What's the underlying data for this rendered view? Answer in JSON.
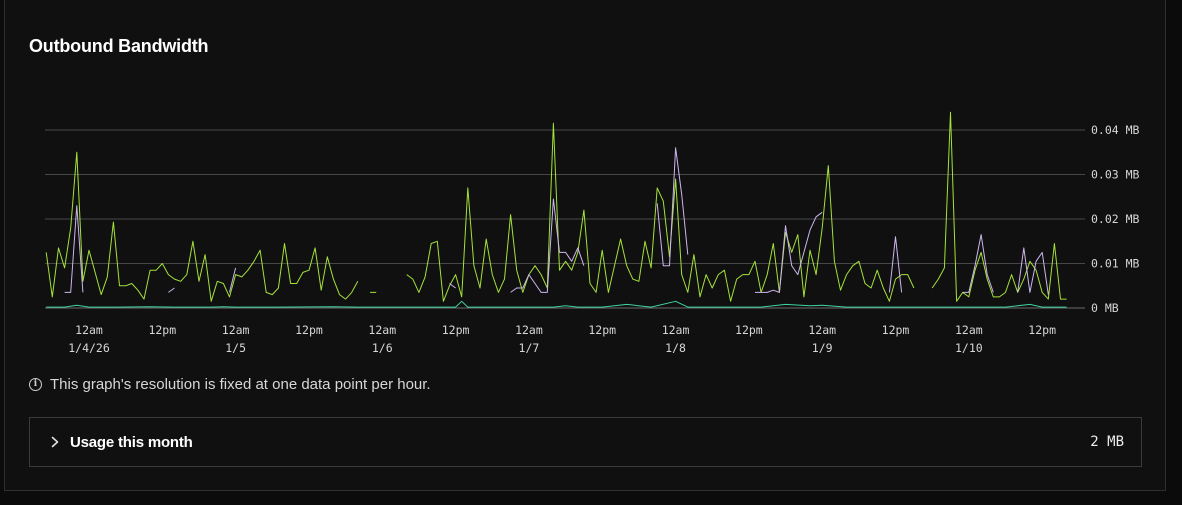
{
  "card": {
    "title": "Outbound Bandwidth",
    "resolution_note": "This graph's resolution is fixed at one data point per hour."
  },
  "usage": {
    "label": "Usage this month",
    "value": "2 MB"
  },
  "colors": {
    "series_green": "#a4e23a",
    "series_purple": "#cdb6ef",
    "series_teal": "#3fd3a0",
    "gridline": "#474747",
    "background": "#101010"
  },
  "chart_data": {
    "type": "line",
    "title": "Outbound Bandwidth",
    "y_unit": "MB",
    "ylim": [
      0,
      0.04
    ],
    "y_ticks": [
      {
        "value": 0,
        "label": "0 MB"
      },
      {
        "value": 0.01,
        "label": "0.01 MB"
      },
      {
        "value": 0.02,
        "label": "0.02 MB"
      },
      {
        "value": 0.03,
        "label": "0.03 MB"
      },
      {
        "value": 0.04,
        "label": "0.04 MB"
      }
    ],
    "x_ticks": [
      {
        "hour": 0,
        "time": "12am",
        "date": "1/4/26"
      },
      {
        "hour": 12,
        "time": "12pm",
        "date": ""
      },
      {
        "hour": 24,
        "time": "12am",
        "date": "1/5"
      },
      {
        "hour": 36,
        "time": "12pm",
        "date": ""
      },
      {
        "hour": 48,
        "time": "12am",
        "date": "1/6"
      },
      {
        "hour": 60,
        "time": "12pm",
        "date": ""
      },
      {
        "hour": 72,
        "time": "12am",
        "date": "1/7"
      },
      {
        "hour": 84,
        "time": "12pm",
        "date": ""
      },
      {
        "hour": 96,
        "time": "12am",
        "date": "1/8"
      },
      {
        "hour": 108,
        "time": "12pm",
        "date": ""
      },
      {
        "hour": 120,
        "time": "12am",
        "date": "1/9"
      },
      {
        "hour": 132,
        "time": "12pm",
        "date": ""
      },
      {
        "hour": 144,
        "time": "12am",
        "date": "1/10"
      },
      {
        "hour": 156,
        "time": "12pm",
        "date": ""
      }
    ],
    "x_range_hours": [
      -7,
      160
    ],
    "grid": true,
    "legend": "none",
    "series": [
      {
        "color": "#a4e23a",
        "points": [
          [
            -7,
            0.0125
          ],
          [
            -6,
            0.0025
          ],
          [
            -5,
            0.0135
          ],
          [
            -4,
            0.009
          ],
          [
            -3,
            0.018
          ],
          [
            -2,
            0.035
          ],
          [
            -1,
            0.006
          ],
          [
            0,
            0.013
          ],
          [
            1,
            0.008
          ],
          [
            2,
            0.003
          ],
          [
            3,
            0.007
          ],
          [
            4,
            0.0193
          ],
          [
            5,
            0.005
          ],
          [
            6,
            0.005
          ],
          [
            7,
            0.0055
          ],
          [
            8,
            0.004
          ],
          [
            9,
            0.002
          ],
          [
            10,
            0.0085
          ],
          [
            11,
            0.0085
          ],
          [
            12,
            0.01
          ],
          [
            13,
            0.0075
          ],
          [
            14,
            0.0065
          ],
          [
            15,
            0.006
          ],
          [
            16,
            0.0075
          ],
          [
            17,
            0.015
          ],
          [
            18,
            0.006
          ],
          [
            19,
            0.012
          ],
          [
            20,
            0.0015
          ],
          [
            21,
            0.006
          ],
          [
            22,
            0.0055
          ],
          [
            23,
            0.0025
          ],
          [
            24,
            0.0075
          ],
          [
            25,
            0.007
          ],
          [
            26,
            0.0085
          ],
          [
            27,
            0.0105
          ],
          [
            28,
            0.013
          ],
          [
            29,
            0.0035
          ],
          [
            30,
            0.003
          ],
          [
            31,
            0.0045
          ],
          [
            32,
            0.0145
          ],
          [
            33,
            0.0055
          ],
          [
            34,
            0.0055
          ],
          [
            35,
            0.008
          ],
          [
            36,
            0.0085
          ],
          [
            37,
            0.0135
          ],
          [
            38,
            0.004
          ],
          [
            39,
            0.0115
          ],
          [
            40,
            0.0065
          ],
          [
            41,
            0.003
          ],
          [
            42,
            0.002
          ],
          [
            43,
            0.0035
          ],
          [
            44,
            0.006
          ],
          [
            null,
            null
          ],
          [
            46,
            0.0035
          ],
          [
            47,
            0.0035
          ],
          [
            null,
            null
          ],
          [
            52,
            0.0075
          ],
          [
            53,
            0.0065
          ],
          [
            54,
            0.0035
          ],
          [
            55,
            0.007
          ],
          [
            56,
            0.0145
          ],
          [
            57,
            0.015
          ],
          [
            58,
            0.0015
          ],
          [
            59,
            0.005
          ],
          [
            60,
            0.0075
          ],
          [
            61,
            0.0025
          ],
          [
            62,
            0.027
          ],
          [
            63,
            0.0095
          ],
          [
            64,
            0.0045
          ],
          [
            65,
            0.0155
          ],
          [
            66,
            0.0075
          ],
          [
            67,
            0.0035
          ],
          [
            68,
            0.0065
          ],
          [
            69,
            0.021
          ],
          [
            70,
            0.0085
          ],
          [
            71,
            0.0035
          ],
          [
            72,
            0.0075
          ],
          [
            73,
            0.0095
          ],
          [
            74,
            0.0075
          ],
          [
            75,
            0.0045
          ],
          [
            76,
            0.0415
          ],
          [
            77,
            0.0085
          ],
          [
            78,
            0.0105
          ],
          [
            79,
            0.0085
          ],
          [
            80,
            0.0125
          ],
          [
            81,
            0.022
          ],
          [
            82,
            0.0055
          ],
          [
            83,
            0.0035
          ],
          [
            84,
            0.013
          ],
          [
            85,
            0.0035
          ],
          [
            86,
            0.0095
          ],
          [
            87,
            0.0155
          ],
          [
            88,
            0.0095
          ],
          [
            89,
            0.0065
          ],
          [
            90,
            0.006
          ],
          [
            91,
            0.015
          ],
          [
            92,
            0.009
          ],
          [
            93,
            0.027
          ],
          [
            94,
            0.024
          ],
          [
            95,
            0.0115
          ],
          [
            96,
            0.029
          ],
          [
            97,
            0.0075
          ],
          [
            98,
            0.0035
          ],
          [
            99,
            0.012
          ],
          [
            100,
            0.0025
          ],
          [
            101,
            0.0075
          ],
          [
            102,
            0.0045
          ],
          [
            103,
            0.0075
          ],
          [
            104,
            0.0085
          ],
          [
            105,
            0.0015
          ],
          [
            106,
            0.0065
          ],
          [
            107,
            0.0075
          ],
          [
            108,
            0.0075
          ],
          [
            109,
            0.0105
          ],
          [
            110,
            0.0035
          ],
          [
            111,
            0.0075
          ],
          [
            112,
            0.0145
          ],
          [
            113,
            0.0035
          ],
          [
            114,
            0.017
          ],
          [
            115,
            0.0125
          ],
          [
            116,
            0.0165
          ],
          [
            117,
            0.0025
          ],
          [
            118,
            0.013
          ],
          [
            119,
            0.0075
          ],
          [
            120,
            0.018
          ],
          [
            121,
            0.032
          ],
          [
            122,
            0.0105
          ],
          [
            123,
            0.004
          ],
          [
            124,
            0.0075
          ],
          [
            125,
            0.0095
          ],
          [
            126,
            0.0105
          ],
          [
            127,
            0.0055
          ],
          [
            128,
            0.0045
          ],
          [
            129,
            0.0085
          ],
          [
            130,
            0.0045
          ],
          [
            131,
            0.0015
          ],
          [
            132,
            0.0065
          ],
          [
            133,
            0.0075
          ],
          [
            134,
            0.0075
          ],
          [
            135,
            0.0045
          ],
          [
            null,
            null
          ],
          [
            138,
            0.0045
          ],
          [
            139,
            0.0065
          ],
          [
            140,
            0.009
          ],
          [
            141,
            0.044
          ],
          [
            142,
            0.0015
          ],
          [
            143,
            0.0035
          ],
          [
            144,
            0.0025
          ],
          [
            145,
            0.0085
          ],
          [
            146,
            0.0125
          ],
          [
            147,
            0.0065
          ],
          [
            148,
            0.0025
          ],
          [
            149,
            0.0025
          ],
          [
            150,
            0.0035
          ],
          [
            151,
            0.0075
          ],
          [
            152,
            0.0035
          ],
          [
            153,
            0.0065
          ],
          [
            154,
            0.0105
          ],
          [
            155,
            0.0085
          ],
          [
            156,
            0.0035
          ],
          [
            157,
            0.002
          ],
          [
            158,
            0.0145
          ],
          [
            159,
            0.002
          ],
          [
            160,
            0.002
          ]
        ]
      },
      {
        "color": "#cdb6ef",
        "points": [
          [
            -4,
            0.0035
          ],
          [
            -3,
            0.0035
          ],
          [
            -2,
            0.023
          ],
          [
            -1,
            0.0035
          ],
          [
            null,
            null
          ],
          [
            13,
            0.0035
          ],
          [
            14,
            0.0045
          ],
          [
            null,
            null
          ],
          [
            23,
            0.0035
          ],
          [
            24,
            0.009
          ],
          [
            null,
            null
          ],
          [
            59,
            0.0055
          ],
          [
            60,
            0.0045
          ],
          [
            null,
            null
          ],
          [
            69,
            0.0035
          ],
          [
            70,
            0.0045
          ],
          [
            71,
            0.0045
          ],
          [
            72,
            0.0075
          ],
          [
            73,
            0.0055
          ],
          [
            74,
            0.0035
          ],
          [
            75,
            0.0035
          ],
          [
            76,
            0.0245
          ],
          [
            77,
            0.0125
          ],
          [
            78,
            0.0125
          ],
          [
            79,
            0.0105
          ],
          [
            80,
            0.0135
          ],
          [
            81,
            0.0095
          ],
          [
            null,
            null
          ],
          [
            93,
            0.0235
          ],
          [
            94,
            0.0095
          ],
          [
            95,
            0.0095
          ],
          [
            96,
            0.036
          ],
          [
            97,
            0.0255
          ],
          [
            98,
            0.012
          ],
          [
            null,
            null
          ],
          [
            109,
            0.0035
          ],
          [
            110,
            0.0035
          ],
          [
            111,
            0.0035
          ],
          [
            112,
            0.004
          ],
          [
            113,
            0.0035
          ],
          [
            114,
            0.0185
          ],
          [
            115,
            0.0095
          ],
          [
            116,
            0.0075
          ],
          [
            117,
            0.0125
          ],
          [
            118,
            0.0175
          ],
          [
            119,
            0.0205
          ],
          [
            120,
            0.0215
          ],
          [
            null,
            null
          ],
          [
            131,
            0.0035
          ],
          [
            132,
            0.016
          ],
          [
            133,
            0.0035
          ],
          [
            null,
            null
          ],
          [
            143,
            0.0035
          ],
          [
            144,
            0.0035
          ],
          [
            145,
            0.0095
          ],
          [
            146,
            0.0165
          ],
          [
            147,
            0.0075
          ],
          [
            148,
            0.0035
          ],
          [
            null,
            null
          ],
          [
            152,
            0.0035
          ],
          [
            153,
            0.0135
          ],
          [
            154,
            0.0035
          ],
          [
            155,
            0.0105
          ],
          [
            156,
            0.0125
          ],
          [
            157,
            0.003
          ]
        ]
      },
      {
        "color": "#3fd3a0",
        "points": [
          [
            -7,
            0.0002
          ],
          [
            -4,
            0.0002
          ],
          [
            -2,
            0.0006
          ],
          [
            0,
            0.0002
          ],
          [
            4,
            0.0002
          ],
          [
            10,
            0.0003
          ],
          [
            14,
            0.0002
          ],
          [
            16,
            0.0002
          ],
          [
            18,
            0.0002
          ],
          [
            20,
            0.0002
          ],
          [
            22,
            0.0003
          ],
          [
            24,
            0.0002
          ],
          [
            30,
            0.0002
          ],
          [
            40,
            0.0003
          ],
          [
            44,
            0.0002
          ],
          [
            48,
            0.0002
          ],
          [
            54,
            0.0002
          ],
          [
            60,
            0.0002
          ],
          [
            61,
            0.0015
          ],
          [
            62,
            0.0002
          ],
          [
            66,
            0.0002
          ],
          [
            70,
            0.0002
          ],
          [
            72,
            0.0002
          ],
          [
            76,
            0.0002
          ],
          [
            78,
            0.0005
          ],
          [
            80,
            0.0002
          ],
          [
            84,
            0.0002
          ],
          [
            88,
            0.0008
          ],
          [
            92,
            0.0002
          ],
          [
            96,
            0.0015
          ],
          [
            98,
            0.0002
          ],
          [
            104,
            0.0002
          ],
          [
            110,
            0.0002
          ],
          [
            114,
            0.0008
          ],
          [
            118,
            0.0005
          ],
          [
            120,
            0.0006
          ],
          [
            124,
            0.0002
          ],
          [
            130,
            0.0002
          ],
          [
            136,
            0.0002
          ],
          [
            140,
            0.0002
          ],
          [
            144,
            0.0002
          ],
          [
            150,
            0.0002
          ],
          [
            154,
            0.0008
          ],
          [
            156,
            0.0002
          ],
          [
            160,
            0.0002
          ]
        ]
      }
    ]
  }
}
